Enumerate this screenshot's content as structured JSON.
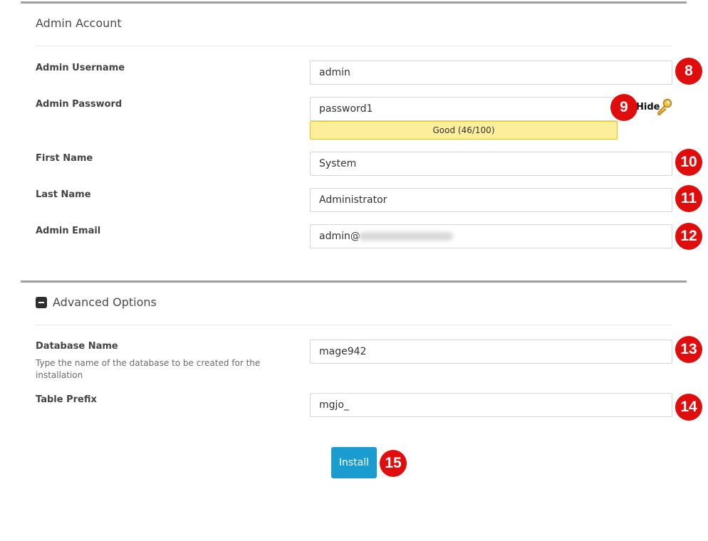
{
  "admin_account": {
    "title": "Admin Account",
    "username": {
      "label": "Admin Username",
      "value": "admin"
    },
    "password": {
      "label": "Admin Password",
      "value": "password1",
      "hide_label": "Hide",
      "strength_text": "Good (46/100)",
      "strength_score": 46
    },
    "first_name": {
      "label": "First Name",
      "value": "System"
    },
    "last_name": {
      "label": "Last Name",
      "value": "Administrator"
    },
    "email": {
      "label": "Admin Email",
      "value_visible": "admin@"
    }
  },
  "advanced": {
    "title": "Advanced Options",
    "database": {
      "label": "Database Name",
      "hint": "Type the name of the database to be created for the installation",
      "value": "mage942"
    },
    "prefix": {
      "label": "Table Prefix",
      "value": "mgjo_"
    }
  },
  "install_label": "Install",
  "badges": [
    "8",
    "9",
    "10",
    "11",
    "12",
    "13",
    "14",
    "15"
  ],
  "colors": {
    "badge": "#e00d0d",
    "install_button": "#1a9cd1",
    "strength_bar": "#fdee9c",
    "strength_border": "#e6c900",
    "rule": "#a0a0a0",
    "key_icon": "#e0a020"
  },
  "icons": {
    "section_toggle": "minus-square-icon",
    "password_visibility": "key-icon"
  }
}
